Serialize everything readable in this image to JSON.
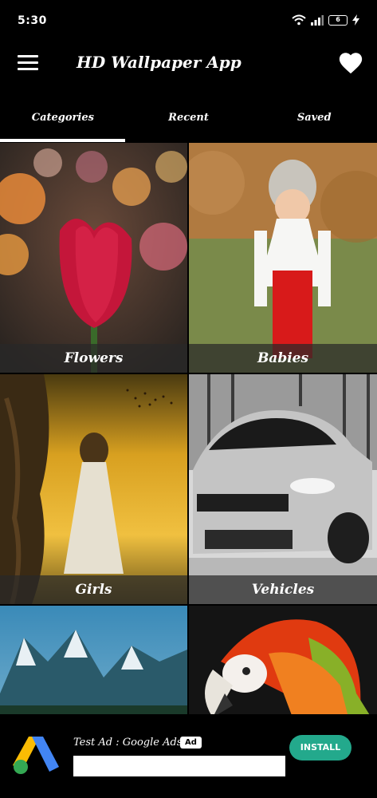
{
  "status_bar": {
    "time": "5:30",
    "battery": "6"
  },
  "app_bar": {
    "title": "HD Wallpaper App"
  },
  "tabs": [
    {
      "label": "Categories",
      "selected": true
    },
    {
      "label": "Recent",
      "selected": false
    },
    {
      "label": "Saved",
      "selected": false
    }
  ],
  "categories": [
    {
      "label": "Flowers"
    },
    {
      "label": "Babies"
    },
    {
      "label": "Girls"
    },
    {
      "label": "Vehicles"
    },
    {
      "label": ""
    },
    {
      "label": ""
    }
  ],
  "ad": {
    "title": "Test Ad : Google Ads",
    "badge": "Ad",
    "install_label": "INSTALL"
  },
  "colors": {
    "background": "#000000",
    "install_button": "#23a98c"
  }
}
